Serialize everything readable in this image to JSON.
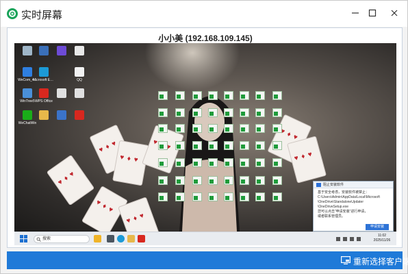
{
  "window": {
    "title": "实时屏幕",
    "controls": [
      "minimize",
      "maximize",
      "close"
    ]
  },
  "viewer": {
    "caption": "小小美 (192.168.109.145)"
  },
  "remote_desktop": {
    "desktop_icons": [
      {
        "label": "",
        "icon": "recycle-bin-icon",
        "color": "#9fb6c8"
      },
      {
        "label": "",
        "icon": "computer-icon",
        "color": "#3a6fb8"
      },
      {
        "label": "",
        "icon": "app-icon",
        "color": "#6d4bd6"
      },
      {
        "label": "",
        "icon": "file-icon",
        "color": "#e8e8e8"
      },
      {
        "label": "WeCom_4...",
        "icon": "installer-icon",
        "color": "#2f7fe0"
      },
      {
        "label": "Microsoft Edge",
        "icon": "edge-icon",
        "color": "#1c9ad6"
      },
      {
        "label": "QQ",
        "icon": "qq-icon",
        "color": "#f2f2f2"
      },
      {
        "label": "WinTree5",
        "icon": "app-icon",
        "color": "#4a90d9"
      },
      {
        "label": "WPS Office",
        "icon": "wps-icon",
        "color": "#d8281f"
      },
      {
        "label": "",
        "icon": "file-icon",
        "color": "#e0e0e0"
      },
      {
        "label": "",
        "icon": "file-icon",
        "color": "#e0e0e0"
      },
      {
        "label": "WeChatWin",
        "icon": "wechat-icon",
        "color": "#1aad19"
      },
      {
        "label": "",
        "icon": "folder-icon",
        "color": "#e7b84a"
      },
      {
        "label": "",
        "icon": "app-icon",
        "color": "#3b73c9"
      },
      {
        "label": "",
        "icon": "netease-music-icon",
        "color": "#d8281f"
      }
    ],
    "notification": {
      "title": "阻止安装软件",
      "body": "基于安全考虑，安装软件被禁止：\nC:\\Users\\Admin\\AppData\\Local\\Microsoft\n\\OneDrive\\StandaloneUpdater\n\\OneDriveSetup.exe\n您可以点击“申请安装”进行申请，\n或者联系管理员。",
      "button_label": "申请安装"
    },
    "taskbar": {
      "search_placeholder": "搜索",
      "time": "11:02",
      "date": "2025/11/26"
    }
  },
  "footer": {
    "reselect_label": "重新选择客户端"
  },
  "colors": {
    "accent": "#1f7ad8",
    "app_icon": "#1aa35a",
    "popup_button": "#2d73d6"
  }
}
